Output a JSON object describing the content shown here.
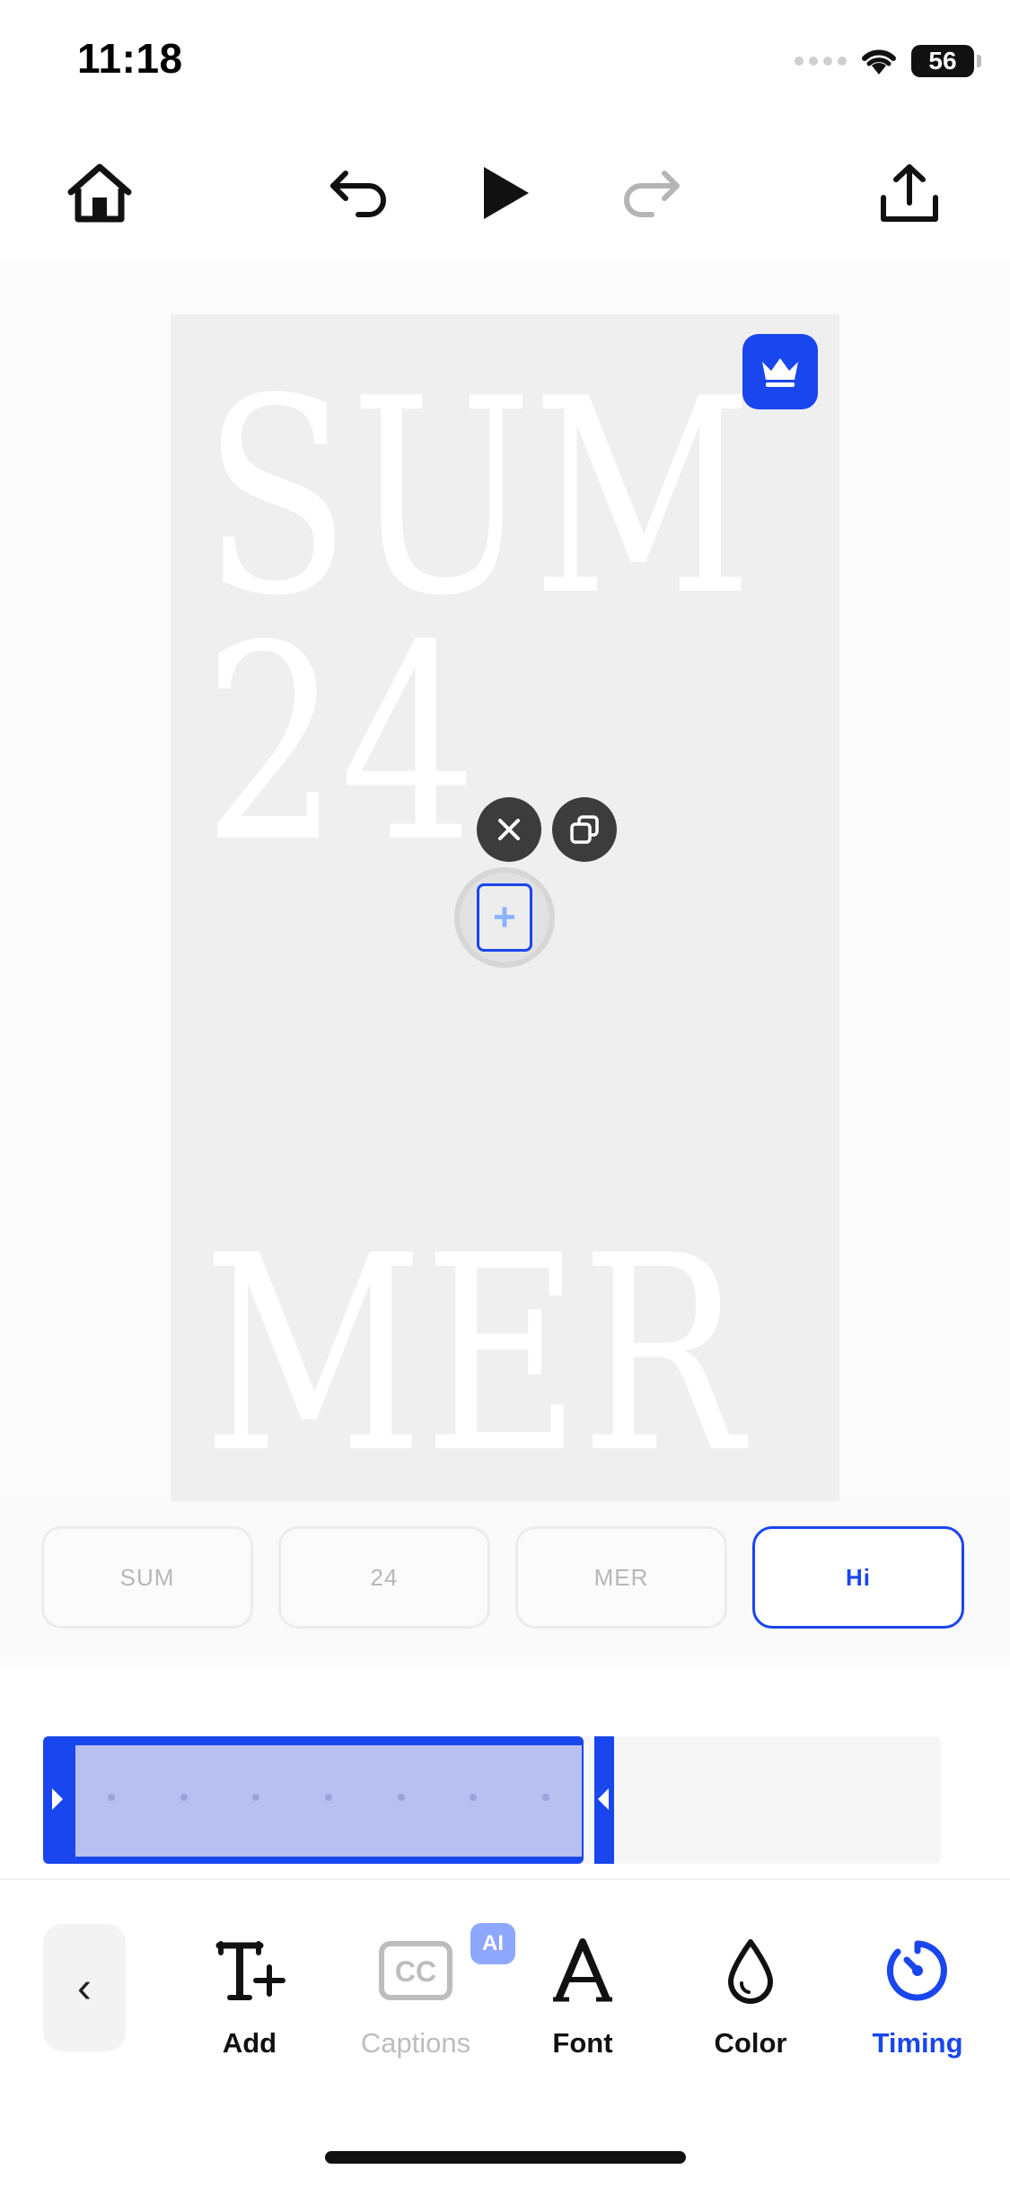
{
  "status": {
    "time": "11:18",
    "battery": "56"
  },
  "canvas": {
    "lines": [
      "SUM",
      "24",
      "MER"
    ]
  },
  "layers": [
    {
      "label": "SUM",
      "active": false
    },
    {
      "label": "24",
      "active": false
    },
    {
      "label": "MER",
      "active": false
    },
    {
      "label": "Hi",
      "active": true
    }
  ],
  "toolbar": {
    "back": "‹",
    "tools": [
      {
        "label": "Add",
        "icon": "text-add-icon",
        "state": "normal"
      },
      {
        "label": "Captions",
        "icon": "captions-icon",
        "state": "disabled",
        "badge": "AI"
      },
      {
        "label": "Font",
        "icon": "font-icon",
        "state": "normal"
      },
      {
        "label": "Color",
        "icon": "color-drop-icon",
        "state": "normal"
      },
      {
        "label": "Timing",
        "icon": "timing-icon",
        "state": "active"
      }
    ]
  },
  "colors": {
    "accent": "#1a46ee",
    "clip_fill": "#b8c0f1"
  }
}
